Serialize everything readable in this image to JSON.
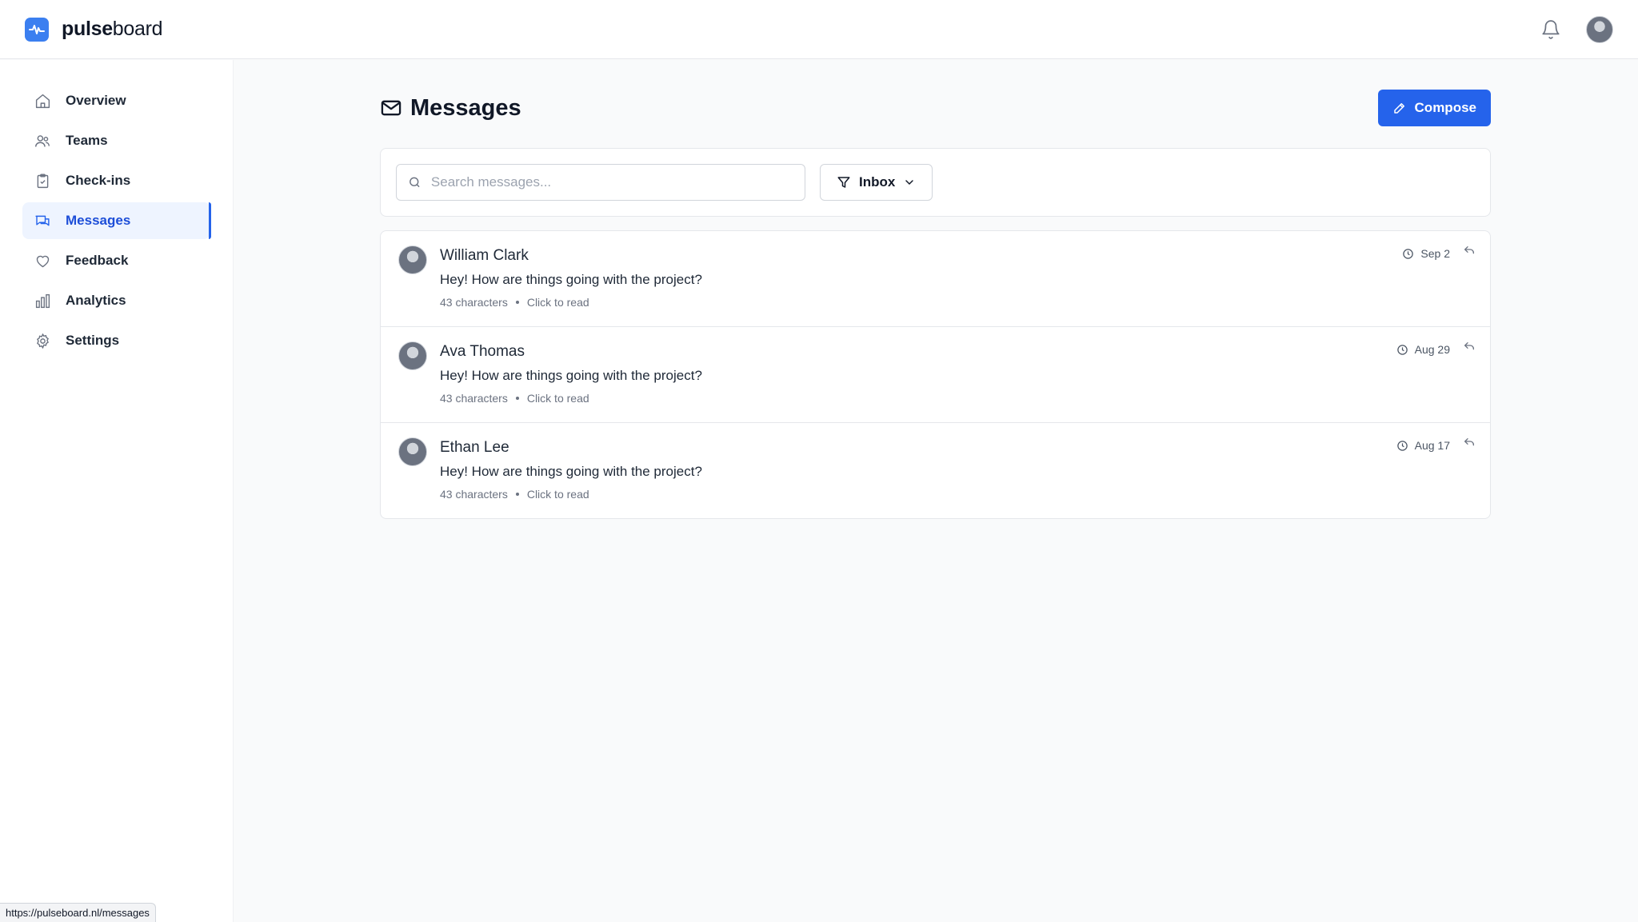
{
  "brand": {
    "bold": "pulse",
    "light": "board"
  },
  "sidebar": {
    "items": [
      {
        "label": "Overview",
        "icon": "home-icon"
      },
      {
        "label": "Teams",
        "icon": "users-icon"
      },
      {
        "label": "Check-ins",
        "icon": "clipboard-icon"
      },
      {
        "label": "Messages",
        "icon": "chat-icon",
        "active": true
      },
      {
        "label": "Feedback",
        "icon": "heart-icon"
      },
      {
        "label": "Analytics",
        "icon": "bar-chart-icon"
      },
      {
        "label": "Settings",
        "icon": "gear-icon"
      }
    ]
  },
  "page": {
    "title": "Messages"
  },
  "toolbar": {
    "compose_label": "Compose"
  },
  "search": {
    "placeholder": "Search messages..."
  },
  "filter": {
    "selected": "Inbox"
  },
  "messages": [
    {
      "sender": "William Clark",
      "preview": "Hey! How are things going with the project?",
      "chars": "43 characters",
      "action": "Click to read",
      "date": "Sep 2"
    },
    {
      "sender": "Ava Thomas",
      "preview": "Hey! How are things going with the project?",
      "chars": "43 characters",
      "action": "Click to read",
      "date": "Aug 29"
    },
    {
      "sender": "Ethan Lee",
      "preview": "Hey! How are things going with the project?",
      "chars": "43 characters",
      "action": "Click to read",
      "date": "Aug 17"
    }
  ],
  "status_bar": {
    "url": "https://pulseboard.nl/messages"
  },
  "colors": {
    "accent": "#2563eb",
    "active_bg": "#eef4ff",
    "logo": "#3b7ff0"
  }
}
